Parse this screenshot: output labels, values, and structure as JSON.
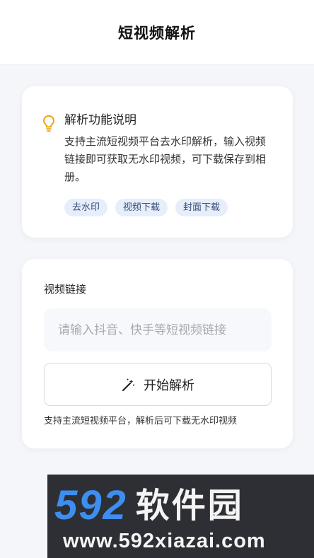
{
  "header": {
    "title": "短视频解析"
  },
  "info": {
    "icon": "lightbulb-icon",
    "title": "解析功能说明",
    "description": "支持主流短视频平台去水印解析，输入视频链接即可获取无水印视频，可下载保存到相册。",
    "tags": [
      "去水印",
      "视频下载",
      "封面下载"
    ]
  },
  "form": {
    "label": "视频链接",
    "input_value": "",
    "input_placeholder": "请输入抖音、快手等短视频链接",
    "button_icon": "magic-wand-icon",
    "button_label": "开始解析",
    "hint": "支持主流短视频平台，解析后可下载无水印视频"
  },
  "watermark": {
    "brand_digits": "592",
    "brand_text": "软件园",
    "url": "www.592xiazai.com"
  },
  "colors": {
    "background": "#f5f6fa",
    "card": "#ffffff",
    "tag_bg": "#e6eefb",
    "bulb": "#e8a317",
    "watermark_blue": "#3d8ef0"
  }
}
